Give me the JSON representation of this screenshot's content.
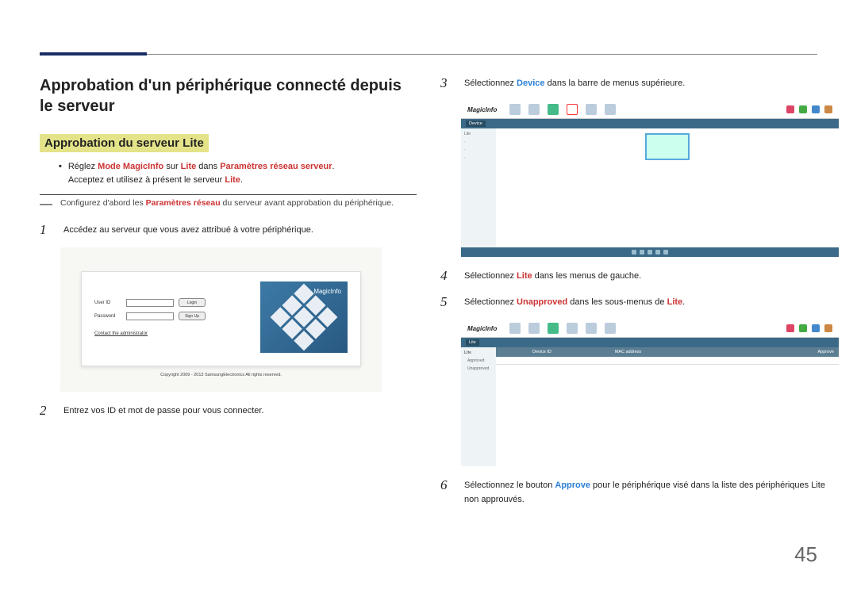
{
  "page_number": "45",
  "heading": "Approbation d'un périphérique connecté depuis le serveur",
  "subheading": "Approbation du serveur Lite",
  "bullet": {
    "prefix": "Réglez ",
    "mode": "Mode MagicInfo",
    "mid1": " sur ",
    "lite1": "Lite",
    "mid2": " dans ",
    "params": "Paramètres réseau serveur",
    "dot": ".",
    "line2a": "Acceptez et utilisez à présent le serveur ",
    "lite2": "Lite",
    "l2dot": "."
  },
  "note": {
    "prefix": "Configurez d'abord les ",
    "params": "Paramètres réseau",
    "suffix": " du serveur avant approbation du périphérique."
  },
  "steps": {
    "s1": "Accédez au serveur que vous avez attribué à votre périphérique.",
    "s2": "Entrez vos ID et mot de passe pour vous connecter.",
    "s3_a": "Sélectionnez ",
    "s3_b": "Device",
    "s3_c": " dans la barre de menus supérieure.",
    "s4_a": "Sélectionnez ",
    "s4_b": "Lite",
    "s4_c": " dans les menus de gauche.",
    "s5_a": "Sélectionnez ",
    "s5_b": "Unapproved",
    "s5_c": " dans les sous-menus de ",
    "s5_d": "Lite",
    "s5_e": ".",
    "s6_a": "Sélectionnez le bouton ",
    "s6_b": "Approve",
    "s6_c": " pour le périphérique visé dans la liste des périphériques Lite non approuvés."
  },
  "login_fig": {
    "user_id": "User ID",
    "password": "Password",
    "login": "Login",
    "signup": "Sign Up",
    "contact": "Contact the administrator",
    "logo": "MagicInfo",
    "copyright": "Copyright 2009 - 2013 SamsungElectronics All rights reserved."
  },
  "dash_fig": {
    "logo": "MagicInfo",
    "tab": "Device",
    "side": [
      "Lite",
      " ",
      " ",
      " ",
      " "
    ]
  },
  "lite_fig": {
    "logo": "MagicInfo",
    "side_top": "Lite",
    "side_items": [
      "Approved",
      "Unapproved"
    ],
    "cols": [
      "",
      "Device ID",
      "",
      "MAC address",
      "Approve"
    ]
  }
}
